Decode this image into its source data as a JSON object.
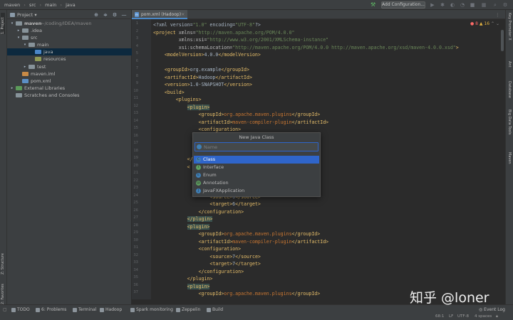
{
  "breadcrumbs": [
    "maven",
    "src",
    "main",
    "java"
  ],
  "toolbar": {
    "add_configuration": "Add Configuration..."
  },
  "left_strip": {
    "project": "1: Project",
    "structure": "Z: Structure",
    "favorites": "2: Favorites"
  },
  "right_strip": {
    "key_promoter": "Key Promoter X",
    "ant": "Ant",
    "database": "Database",
    "big_data": "Big Data Tools",
    "maven": "Maven"
  },
  "project_panel": {
    "title": "Project",
    "tree": [
      {
        "label": "maven",
        "hint": "~/coding/IDEA/maven",
        "indent": 0,
        "arrow": "▾",
        "icon": "plain",
        "bold": true
      },
      {
        "label": ".idea",
        "hint": "",
        "indent": 1,
        "arrow": "▸",
        "icon": "plain"
      },
      {
        "label": "src",
        "hint": "",
        "indent": 1,
        "arrow": "▾",
        "icon": "plain"
      },
      {
        "label": "main",
        "hint": "",
        "indent": 2,
        "arrow": "▾",
        "icon": "plain"
      },
      {
        "label": "java",
        "hint": "",
        "indent": 3,
        "arrow": "",
        "icon": "src",
        "selected": true
      },
      {
        "label": "resources",
        "hint": "",
        "indent": 3,
        "arrow": "",
        "icon": "res"
      },
      {
        "label": "test",
        "hint": "",
        "indent": 2,
        "arrow": "▸",
        "icon": "plain"
      },
      {
        "label": "maven.iml",
        "hint": "",
        "indent": 1,
        "arrow": "",
        "icon": "orange"
      },
      {
        "label": "pom.xml",
        "hint": "",
        "indent": 1,
        "arrow": "",
        "icon": "blue"
      },
      {
        "label": "External Libraries",
        "hint": "",
        "indent": 0,
        "arrow": "▸",
        "icon": "green"
      },
      {
        "label": "Scratches and Consoles",
        "hint": "",
        "indent": 0,
        "arrow": "",
        "icon": "plain"
      }
    ]
  },
  "editor": {
    "tab_label": "pom.xml (Hadoop)",
    "errors": "8",
    "warnings": "16",
    "line_numbers": [
      "1",
      "2",
      "3",
      "4",
      "5",
      "6",
      "7",
      "8",
      "9",
      "10",
      "11",
      "12",
      "13",
      "14",
      "15",
      "16",
      "17",
      "18",
      "19",
      "20",
      "21",
      "22",
      "23",
      "24",
      "25",
      "26",
      "27",
      "28",
      "29",
      "30",
      "31",
      "32",
      "33",
      "34",
      "35",
      "36",
      "37"
    ],
    "lines": [
      [
        [
          "txt",
          "<?xml version="
        ],
        [
          "str",
          "\"1.0\""
        ],
        [
          "txt",
          " encoding="
        ],
        [
          "str",
          "\"UTF-8\""
        ],
        [
          "txt",
          "?>"
        ]
      ],
      [
        [
          "tag",
          "<project "
        ],
        [
          "attr",
          "xmlns="
        ],
        [
          "str",
          "\"http://maven.apache.org/POM/4.0.0\""
        ]
      ],
      [
        [
          "attr",
          "         xmlns:xsi="
        ],
        [
          "str",
          "\"http://www.w3.org/2001/XMLSchema-instance\""
        ]
      ],
      [
        [
          "attr",
          "         xsi:schemaLocation="
        ],
        [
          "str",
          "\"http://maven.apache.org/POM/4.0.0 http://maven.apache.org/xsd/maven-4.0.0.xsd\""
        ],
        [
          "tag",
          ">"
        ]
      ],
      [
        [
          "txt",
          "    "
        ],
        [
          "tag",
          "<modelVersion>"
        ],
        [
          "txt",
          "4.0.0"
        ],
        [
          "tag",
          "</modelVersion>"
        ]
      ],
      [],
      [
        [
          "txt",
          "    "
        ],
        [
          "tag",
          "<groupId>"
        ],
        [
          "txt",
          "org.example"
        ],
        [
          "tag",
          "</groupId>"
        ]
      ],
      [
        [
          "txt",
          "    "
        ],
        [
          "tag",
          "<artifactId>"
        ],
        [
          "txt",
          "Hadoop"
        ],
        [
          "tag",
          "</artifactId>"
        ]
      ],
      [
        [
          "txt",
          "    "
        ],
        [
          "tag",
          "<version>"
        ],
        [
          "txt",
          "1.0-SNAPSHOT"
        ],
        [
          "tag",
          "</version>"
        ]
      ],
      [
        [
          "txt",
          "    "
        ],
        [
          "tag",
          "<build>"
        ]
      ],
      [
        [
          "txt",
          "        "
        ],
        [
          "tag",
          "<plugins>"
        ]
      ],
      [
        [
          "txt",
          "            "
        ],
        [
          "tagh",
          "<plugin>"
        ]
      ],
      [
        [
          "txt",
          "                "
        ],
        [
          "tag",
          "<groupId>"
        ],
        [
          "red",
          "org.apache.maven.plugins"
        ],
        [
          "tag",
          "</groupId>"
        ]
      ],
      [
        [
          "txt",
          "                "
        ],
        [
          "tag",
          "<artifactId>"
        ],
        [
          "red",
          "maven-compiler-plugin"
        ],
        [
          "tag",
          "</artifactId>"
        ]
      ],
      [
        [
          "txt",
          "                "
        ],
        [
          "tag",
          "<configuration>"
        ]
      ],
      [],
      [],
      [],
      [
        [
          "txt",
          "            "
        ],
        [
          "tag",
          "</"
        ]
      ],
      [
        [
          "txt",
          "            "
        ],
        [
          "tag",
          "<"
        ]
      ],
      [
        [
          "txt",
          "                                                      "
        ],
        [
          "tag",
          ">"
        ]
      ],
      [
        [
          "txt",
          "                                                      "
        ],
        [
          "tag",
          "Id>"
        ]
      ],
      [],
      [
        [
          "txt",
          "                    "
        ],
        [
          "tag",
          "<source>"
        ],
        [
          "txt",
          "6"
        ],
        [
          "tag",
          "</source>"
        ]
      ],
      [
        [
          "txt",
          "                    "
        ],
        [
          "tag",
          "<target>"
        ],
        [
          "txt",
          "6"
        ],
        [
          "tag",
          "</target>"
        ]
      ],
      [
        [
          "txt",
          "                "
        ],
        [
          "tag",
          "</configuration>"
        ]
      ],
      [
        [
          "txt",
          "            "
        ],
        [
          "tagh",
          "</plugin>"
        ]
      ],
      [
        [
          "txt",
          "            "
        ],
        [
          "tagh",
          "<plugin>"
        ]
      ],
      [
        [
          "txt",
          "                "
        ],
        [
          "tag",
          "<groupId>"
        ],
        [
          "red",
          "org.apache.maven.plugins"
        ],
        [
          "tag",
          "</groupId>"
        ]
      ],
      [
        [
          "txt",
          "                "
        ],
        [
          "tag",
          "<artifactId>"
        ],
        [
          "red",
          "maven-compiler-plugin"
        ],
        [
          "tag",
          "</artifactId>"
        ]
      ],
      [
        [
          "txt",
          "                "
        ],
        [
          "tag",
          "<configuration>"
        ]
      ],
      [
        [
          "txt",
          "                    "
        ],
        [
          "tag",
          "<source>"
        ],
        [
          "txt",
          "7"
        ],
        [
          "tag",
          "</source>"
        ]
      ],
      [
        [
          "txt",
          "                    "
        ],
        [
          "tag",
          "<target>"
        ],
        [
          "txt",
          "7"
        ],
        [
          "tag",
          "</target>"
        ]
      ],
      [
        [
          "txt",
          "                "
        ],
        [
          "tag",
          "</configuration>"
        ]
      ],
      [
        [
          "txt",
          "            "
        ],
        [
          "tag",
          "</plugin>"
        ]
      ],
      [
        [
          "txt",
          "            "
        ],
        [
          "tagh",
          "<plugin>"
        ]
      ],
      [
        [
          "txt",
          "                "
        ],
        [
          "tag",
          "<groupId>"
        ],
        [
          "red",
          "org.apache.maven.plugins"
        ],
        [
          "tag",
          "</groupId>"
        ]
      ]
    ]
  },
  "popup": {
    "title": "New Java Class",
    "placeholder": "Name",
    "items": [
      {
        "label": "Class",
        "icon_color": "#3f7fb6",
        "letter": "C",
        "selected": true
      },
      {
        "label": "Interface",
        "icon_color": "#5fa061",
        "letter": "I"
      },
      {
        "label": "Enum",
        "icon_color": "#3f7fb6",
        "letter": "E"
      },
      {
        "label": "Annotation",
        "icon_color": "#5fa061",
        "letter": "@"
      },
      {
        "label": "JavaFXApplication",
        "icon_color": "#3f7fb6",
        "letter": "J"
      }
    ]
  },
  "bottom_tools": [
    "TODO",
    "6: Problems",
    "Terminal",
    "Hadoop",
    "Spark monitoring",
    "Zeppelin",
    "Build"
  ],
  "event_log": "Event Log",
  "status": {
    "position": "68:1",
    "line_sep": "LF",
    "encoding": "UTF-8",
    "indent": "4 spaces"
  },
  "watermark": "知乎 @loner",
  "colors": {
    "accent": "#2f65ca",
    "selection": "#0d293e",
    "tag": "#e8bf6a",
    "string": "#6a8759"
  }
}
